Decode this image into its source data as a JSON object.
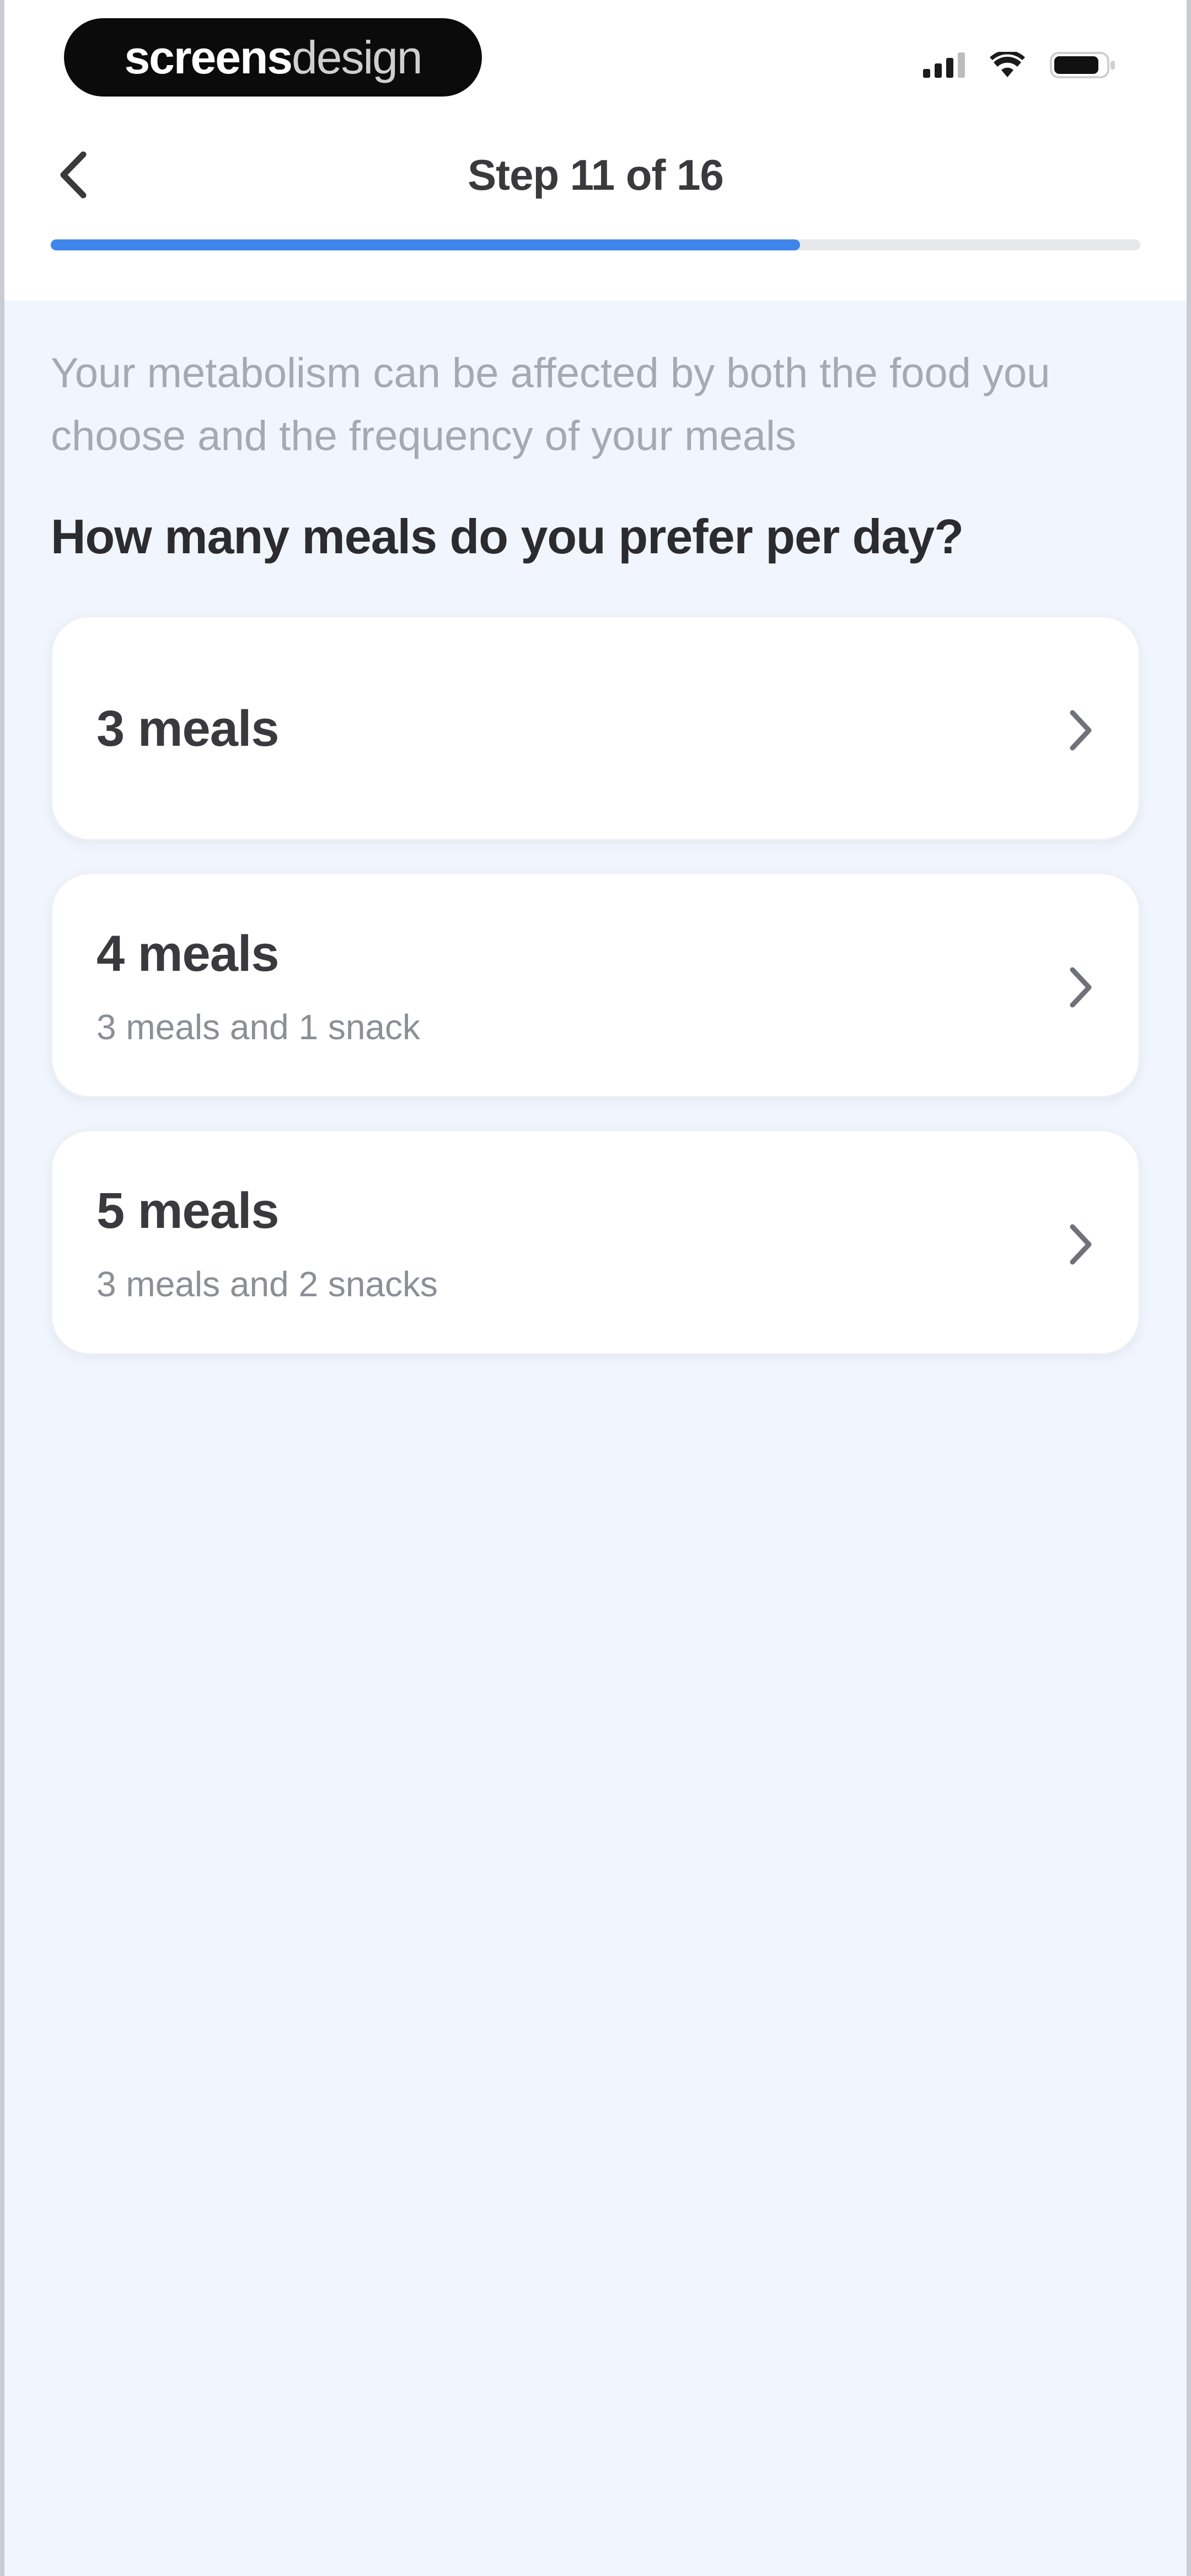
{
  "status_bar": {
    "brand_bold": "screens",
    "brand_light": "design",
    "signal_icon": "signal-bars-icon",
    "wifi_icon": "wifi-icon",
    "battery_icon": "battery-icon"
  },
  "header": {
    "back_icon": "chevron-left-icon",
    "step_title": "Step 11 of 16",
    "progress": {
      "current": 11,
      "total": 16,
      "fill_color": "#3f86ea"
    }
  },
  "main": {
    "intro": "Your metabolism can be affected by both the food you choose and the frequency of your meals",
    "question": "How many meals do you prefer per day?",
    "options": [
      {
        "title": "3 meals",
        "subtitle": "",
        "icon": "chevron-right-icon"
      },
      {
        "title": "4 meals",
        "subtitle": "3 meals and 1 snack",
        "icon": "chevron-right-icon"
      },
      {
        "title": "5 meals",
        "subtitle": "3 meals and 2 snacks",
        "icon": "chevron-right-icon"
      }
    ]
  },
  "colors": {
    "accent": "#3f86ea",
    "background": "#f1f5fd",
    "card": "#ffffff"
  }
}
